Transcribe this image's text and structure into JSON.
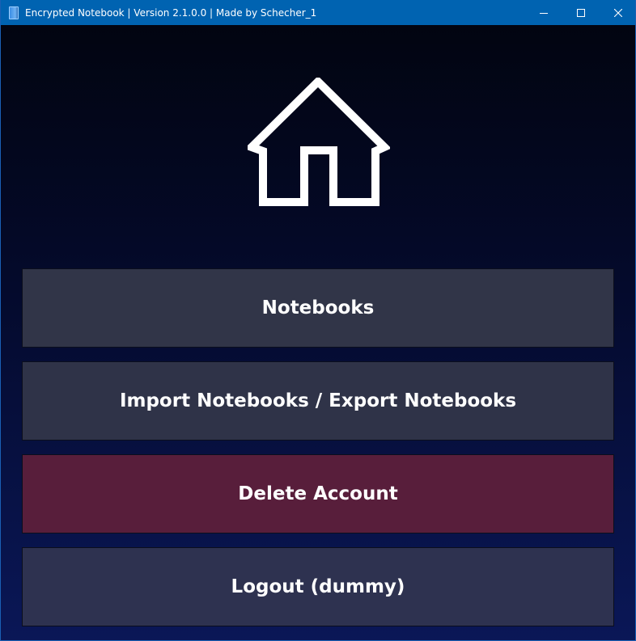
{
  "window": {
    "title": "Encrypted Notebook | Version 2.1.0.0 | Made by Schecher_1",
    "controls": {
      "minimize": "minimize-icon",
      "maximize": "maximize-icon",
      "close": "close-icon"
    }
  },
  "hero": {
    "icon": "home-icon"
  },
  "menu": {
    "notebooks_label": "Notebooks",
    "import_export_label": "Import Notebooks / Export Notebooks",
    "delete_account_label": "Delete Account",
    "logout_label": "Logout (dummy)"
  },
  "colors": {
    "titlebar": "#0063b1",
    "button": "#313548",
    "danger_button": "#581e3b",
    "background_top": "#02040e",
    "background_bottom": "#0a1757"
  }
}
